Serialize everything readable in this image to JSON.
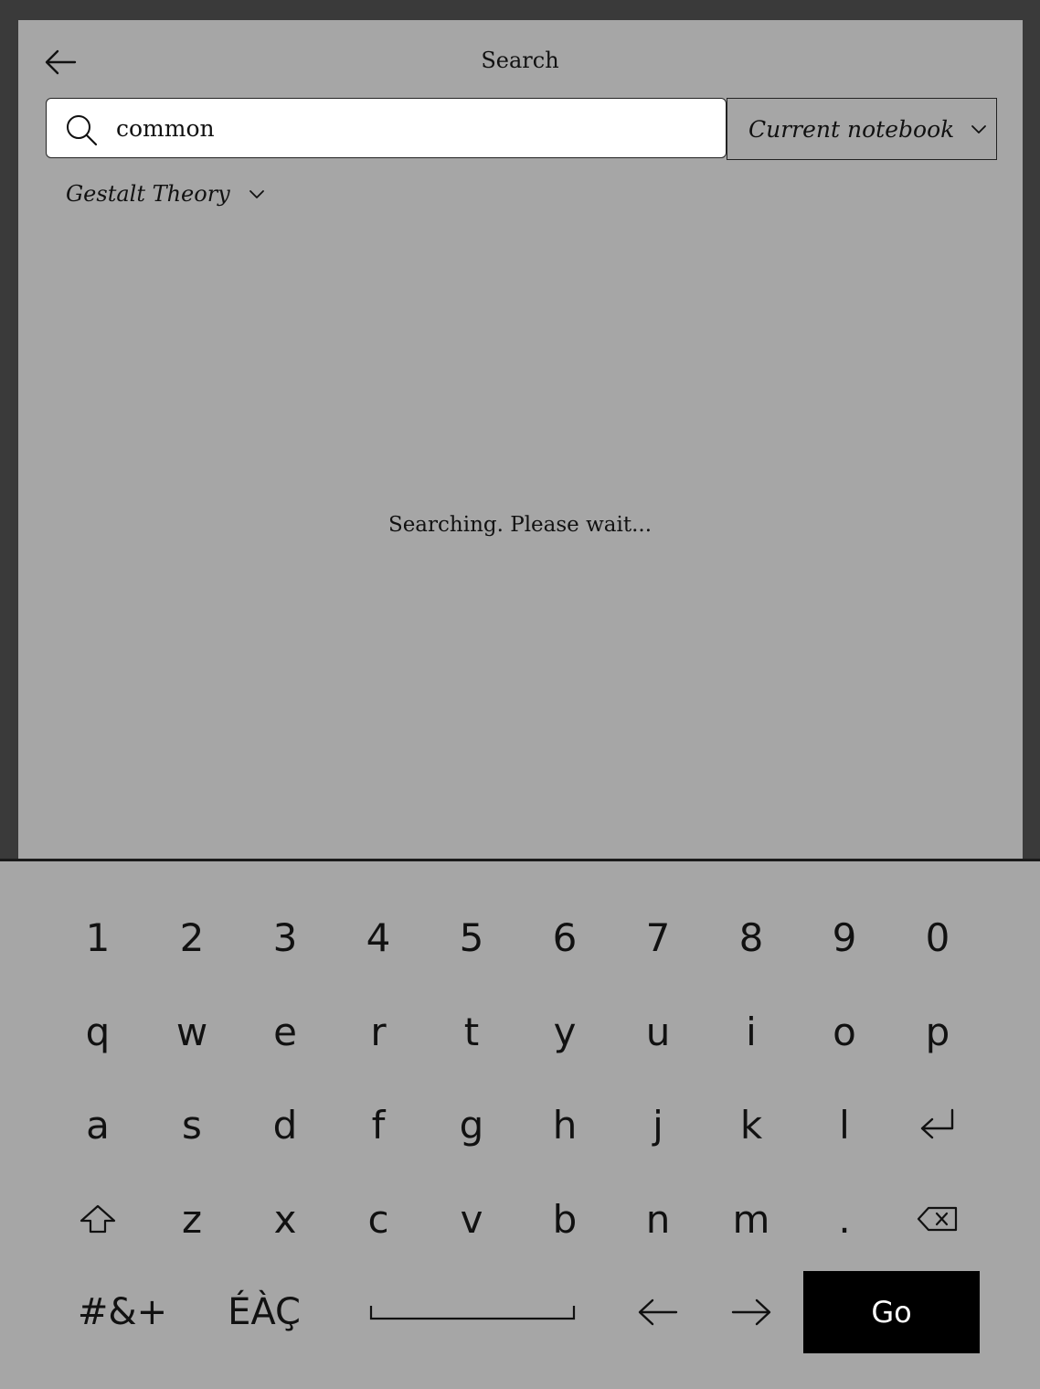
{
  "header": {
    "title": "Search",
    "back_icon": "arrow-left-icon"
  },
  "search": {
    "value": "common",
    "placeholder": "",
    "icon": "search-icon"
  },
  "scope": {
    "selected": "Current notebook",
    "icon": "chevron-down-icon"
  },
  "notebook_filter": {
    "selected": "Gestalt Theory",
    "icon": "chevron-down-icon"
  },
  "status": {
    "message": "Searching. Please wait..."
  },
  "keyboard": {
    "row_numbers": [
      "1",
      "2",
      "3",
      "4",
      "5",
      "6",
      "7",
      "8",
      "9",
      "0"
    ],
    "row_top": [
      "q",
      "w",
      "e",
      "r",
      "t",
      "y",
      "u",
      "i",
      "o",
      "p"
    ],
    "row_middle": [
      "a",
      "s",
      "d",
      "f",
      "g",
      "h",
      "j",
      "k",
      "l"
    ],
    "row_bottom": [
      "z",
      "x",
      "c",
      "v",
      "b",
      "n",
      "m",
      "."
    ],
    "symbols_label": "#&+",
    "accents_label": "ÉÀÇ",
    "go_label": "Go",
    "icons": {
      "enter": "enter-icon",
      "shift": "shift-icon",
      "backspace": "backspace-icon",
      "space": "space-icon",
      "cursor_left": "cursor-left-icon",
      "cursor_right": "cursor-right-icon"
    }
  },
  "colors": {
    "background": "#a6a6a6",
    "frame": "#3a3a3a",
    "search_field": "#ffffff",
    "go_key": "#000000"
  }
}
